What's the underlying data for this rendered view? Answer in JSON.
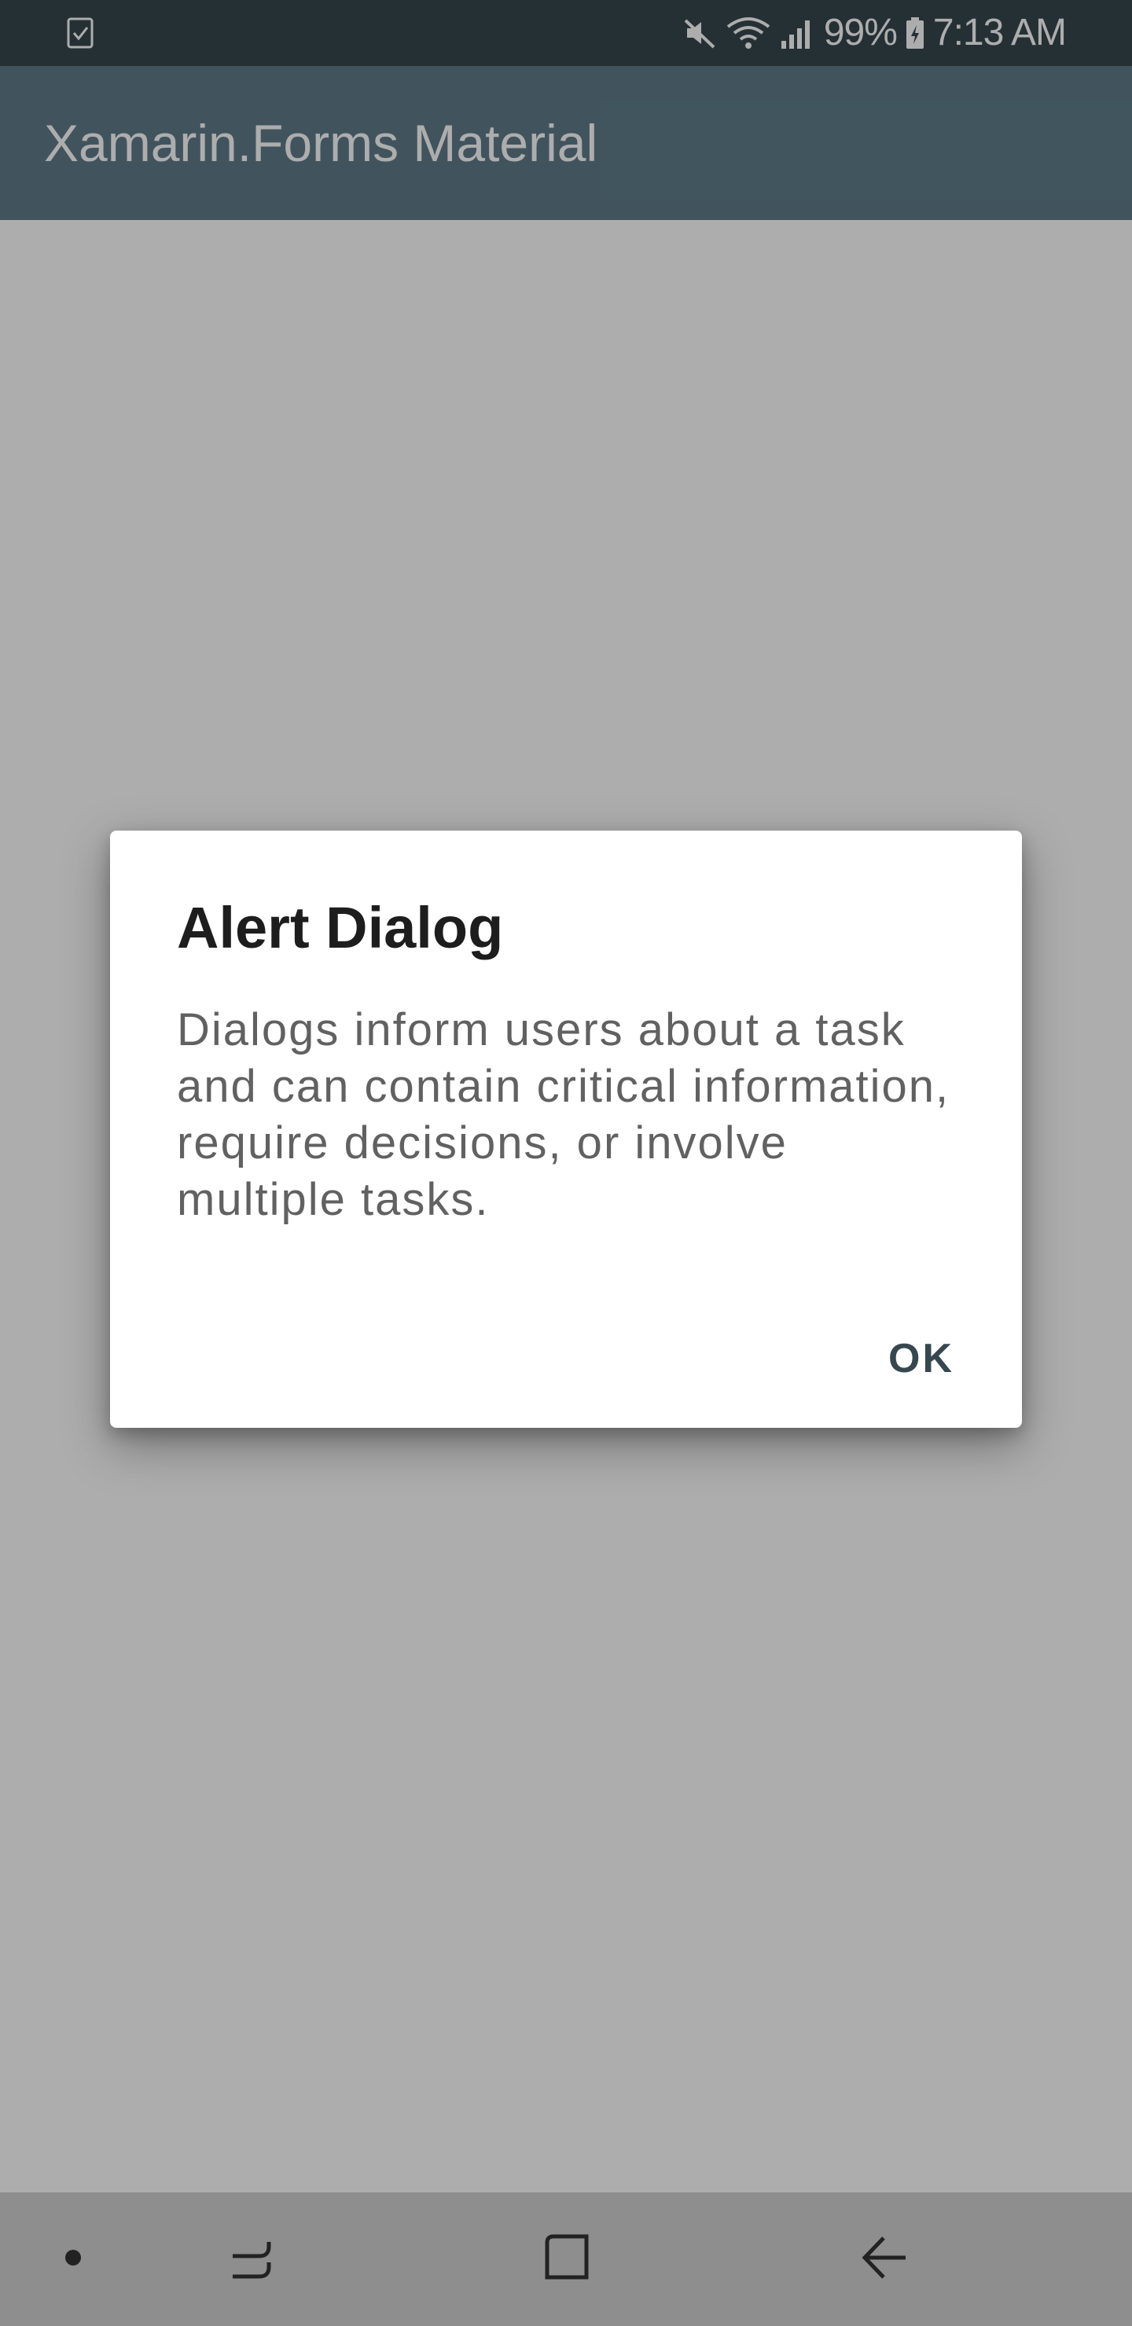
{
  "status_bar": {
    "left_icon": "clipboard-check-icon",
    "icons": [
      "mute-icon",
      "wifi-icon",
      "signal-icon"
    ],
    "battery_percent": "99%",
    "battery_icon": "battery-charging-icon",
    "time": "7:13 AM",
    "background": "#37474f"
  },
  "app_bar": {
    "title": "Xamarin.Forms Material",
    "background": "#607d8b"
  },
  "dialog": {
    "title": "Alert Dialog",
    "message": "Dialogs inform users about a task and can contain critical information, require decisions, or involve multiple tasks.",
    "ok_label": "OK",
    "button_color": "#37474f"
  },
  "nav_bar": {
    "icons": [
      "dot-icon",
      "recents-icon",
      "home-icon",
      "back-icon"
    ]
  }
}
